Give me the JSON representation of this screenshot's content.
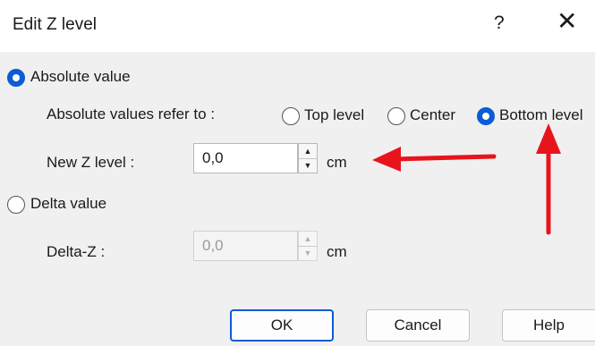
{
  "dialog": {
    "title": "Edit Z level",
    "help_glyph": "?",
    "close_glyph": "✕"
  },
  "mode": {
    "absolute_label": "Absolute value",
    "absolute_selected": true,
    "delta_label": "Delta value",
    "delta_selected": false
  },
  "absolute": {
    "refer_label": "Absolute values refer to :",
    "options": [
      {
        "label": "Top level",
        "selected": false
      },
      {
        "label": "Center",
        "selected": false
      },
      {
        "label": "Bottom level",
        "selected": true
      }
    ],
    "new_z_label": "New Z level :",
    "new_z_value": "0,0",
    "unit": "cm"
  },
  "delta": {
    "label": "Delta-Z :",
    "value": "0,0",
    "unit": "cm",
    "disabled": true
  },
  "buttons": {
    "ok": "OK",
    "cancel": "Cancel",
    "help": "Help"
  },
  "annotation": {
    "arrow_color": "#e8141c"
  },
  "colors": {
    "accent": "#0b5cd5",
    "background": "#f0f0f0"
  }
}
